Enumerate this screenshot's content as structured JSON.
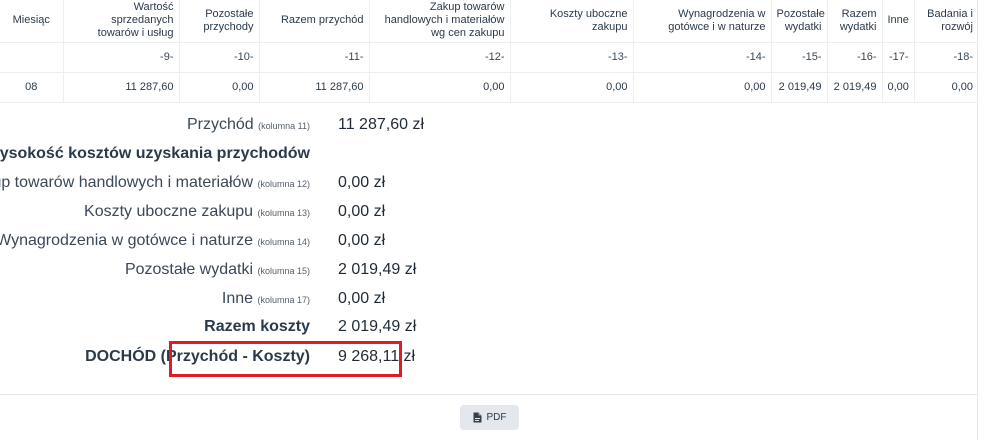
{
  "table": {
    "headers": [
      "Miesiąc",
      "Wartość sprzedanych towarów i usług",
      "Pozostałe przychody",
      "Razem przychód",
      "Zakup towarów handlowych i materiałów wg cen zakupu",
      "Koszty uboczne zakupu",
      "Wynagrodzenia w gotówce i w naturze",
      "Pozostałe wydatki",
      "Razem wydatki",
      "Inne",
      "Badania i rozwój"
    ],
    "column_numbers": [
      "",
      "-9-",
      "-10-",
      "-11-",
      "-12-",
      "-13-",
      "-14-",
      "-15-",
      "-16-",
      "-17-",
      "-18-"
    ],
    "rows": [
      [
        "08",
        "11 287,60",
        "0,00",
        "11 287,60",
        "0,00",
        "0,00",
        "0,00",
        "2 019,49",
        "2 019,49",
        "0,00",
        "0,00"
      ]
    ]
  },
  "summary": {
    "revenue": {
      "label": "Przychód",
      "col": "(kolumna 11)",
      "value": "11 287,60 zł"
    },
    "costs_heading": "Wysokość kosztów uzyskania przychodów",
    "purchase": {
      "label": "Zakup towarów handlowych i materiałów",
      "col": "(kolumna 12)",
      "value": "0,00 zł"
    },
    "side_costs": {
      "label": "Koszty uboczne zakupu",
      "col": "(kolumna 13)",
      "value": "0,00 zł"
    },
    "salaries": {
      "label": "Wynagrodzenia w gotówce i naturze",
      "col": "(kolumna 14)",
      "value": "0,00 zł"
    },
    "other_expenses": {
      "label": "Pozostałe wydatki",
      "col": "(kolumna 15)",
      "value": "2 019,49 zł"
    },
    "other": {
      "label": "Inne",
      "col": "(kolumna 17)",
      "value": "0,00 zł"
    },
    "total_costs": {
      "label": "Razem koszty",
      "value": "2 019,49 zł"
    },
    "income": {
      "label": "DOCHÓD (Przychód - Koszty)",
      "value": "9 268,11 zł"
    }
  },
  "actions": {
    "pdf_label": "PDF",
    "pdf_icon": "file-pdf-icon"
  },
  "colors": {
    "highlight": "#e01b24",
    "button_bg": "#e4e8ed"
  }
}
